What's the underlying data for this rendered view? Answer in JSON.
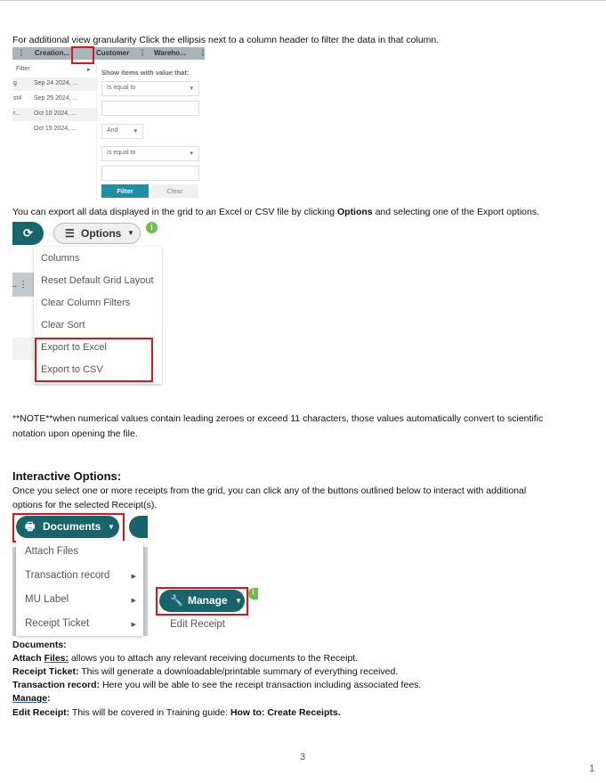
{
  "intro": "For additional view granularity Click the ellipsis next to a column header to filter the data in that column.",
  "grid": {
    "headers": [
      "Creation...",
      "Customer",
      "Wareho..."
    ],
    "filter_label": "Filter",
    "rows": [
      {
        "left": "g",
        "date": "Sep 24 2024, ..."
      },
      {
        "left": "st4",
        "date": "Sep 25 2024, ..."
      },
      {
        "left": "r...",
        "date": "Oct 10 2024, ..."
      },
      {
        "left": "",
        "date": "Oct 15 2024, ..."
      }
    ],
    "panel": {
      "title": "Show items with value that:",
      "operator1": "Is equal to",
      "logic": "And",
      "operator2": "Is equal to",
      "filter_btn": "Filter",
      "clear_btn": "Clear"
    }
  },
  "export_text": {
    "pre": "You can export all data displayed in the grid to an Excel or CSV file by clicking ",
    "bold": "Options",
    "post": " and selecting one of the Export options."
  },
  "options": {
    "label": "Options",
    "items": [
      "Columns",
      "Reset Default Grid Layout",
      "Clear Column Filters",
      "Clear Sort",
      "Export to Excel",
      "Export to CSV"
    ]
  },
  "note": {
    "line1": "**NOTE**when numerical values contain leading zeroes or exceed 11 characters, those values automatically convert to scientific",
    "line2": "notation upon opening the file."
  },
  "interactive": {
    "heading": "Interactive Options:",
    "line1": "Once you select one or more receipts from the grid, you can click any of the buttons outlined below to interact with additional",
    "line2": "options for the selected Receipt(s)."
  },
  "documents": {
    "label": "Documents",
    "items": [
      "Attach Files",
      "Transaction record",
      "MU Label",
      "Receipt Ticket"
    ]
  },
  "manage": {
    "label": "Manage",
    "items": [
      "Edit Receipt"
    ]
  },
  "desc": {
    "documents_heading": "Documents:",
    "attach_a": "Attach ",
    "attach_link": "Files:",
    "attach_rest": " allows you to attach any relevant receiving documents to the Receipt.",
    "ticket_label": "Receipt Ticket:",
    "ticket_rest": " This will generate a downloadable/printable summary of everything received.",
    "trans_label": "Transaction record:",
    "trans_rest": " Here you will be able to see the receipt transaction including associated fees.",
    "manage_link": "Manage",
    "manage_colon": ":",
    "edit_label": "Edit Receipt:",
    "edit_rest": " This will be covered in Training guide: ",
    "edit_bold": "How to: Create Receipts."
  },
  "page_number": "3",
  "corner_number": "1",
  "colors": {
    "teal": "#17656b",
    "highlight": "#e0121b",
    "info": "#6cc04a"
  }
}
